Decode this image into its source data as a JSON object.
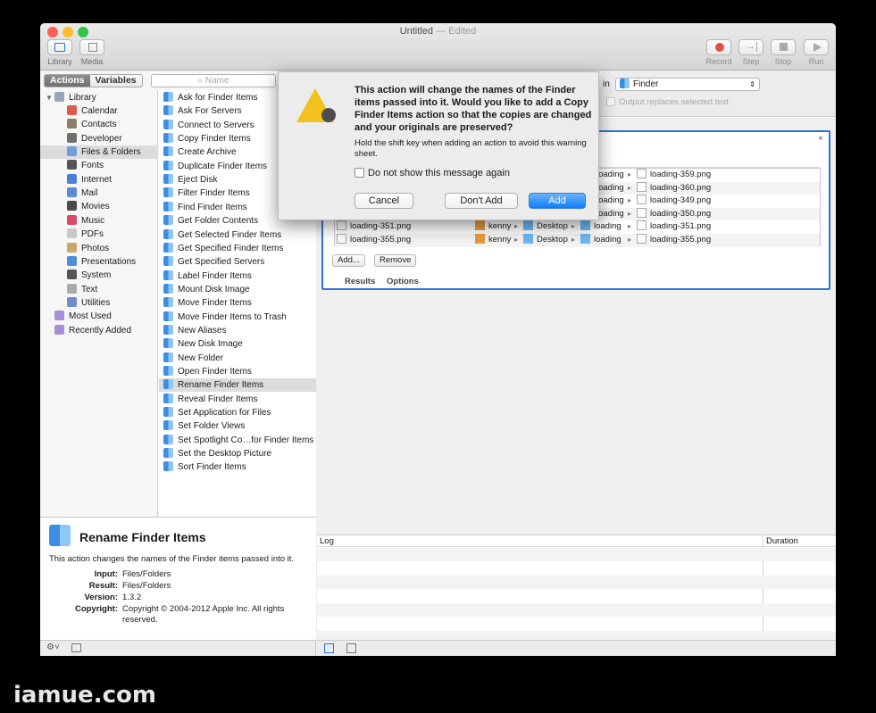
{
  "window": {
    "title": "Untitled",
    "edited": "— Edited"
  },
  "toolbar": {
    "library": "Library",
    "media": "Media",
    "record": "Record",
    "step": "Step",
    "stop": "Stop",
    "run": "Run"
  },
  "tabs": {
    "actions": "Actions",
    "variables": "Variables"
  },
  "search": {
    "placeholder": "Name"
  },
  "library": {
    "root": "Library",
    "items": [
      "Calendar",
      "Contacts",
      "Developer",
      "Files & Folders",
      "Fonts",
      "Internet",
      "Mail",
      "Movies",
      "Music",
      "PDFs",
      "Photos",
      "Presentations",
      "System",
      "Text",
      "Utilities"
    ],
    "selected": "Files & Folders",
    "most_used": "Most Used",
    "recently_added": "Recently Added"
  },
  "actions": {
    "items": [
      "Ask for Finder Items",
      "Ask For Servers",
      "Connect to Servers",
      "Copy Finder Items",
      "Create Archive",
      "Duplicate Finder Items",
      "Eject Disk",
      "Filter Finder Items",
      "Find Finder Items",
      "Get Folder Contents",
      "Get Selected Finder Items",
      "Get Specified Finder Items",
      "Get Specified Servers",
      "Label Finder Items",
      "Mount Disk Image",
      "Move Finder Items",
      "Move Finder Items to Trash",
      "New Aliases",
      "New Disk Image",
      "New Folder",
      "Open Finder Items",
      "Rename Finder Items",
      "Reveal Finder Items",
      "Set Application for Files",
      "Set Folder Views",
      "Set Spotlight Co…for Finder Items",
      "Set the Desktop Picture",
      "Sort Finder Items"
    ],
    "selected": "Rename Finder Items"
  },
  "description": {
    "title": "Rename Finder Items",
    "text": "This action changes the names of the Finder items passed into it.",
    "input_label": "Input:",
    "input": "Files/Folders",
    "result_label": "Result:",
    "result": "Files/Folders",
    "version_label": "Version:",
    "version": "1.3.2",
    "copyright_label": "Copyright:",
    "copyright": "Copyright © 2004-2012 Apple Inc.  All rights reserved."
  },
  "options_bar": {
    "in_label": "in",
    "app": "Finder",
    "output_replaces": "Output replaces selected text"
  },
  "action_box": {
    "rows": [
      {
        "name": "",
        "user": "",
        "desktop": "",
        "folder": "loading",
        "file": "loading-359.png"
      },
      {
        "name": "",
        "user": "",
        "desktop": "",
        "folder": "loading",
        "file": "loading-360.png"
      },
      {
        "name": "",
        "user": "",
        "desktop": "",
        "folder": "loading",
        "file": "loading-349.png"
      },
      {
        "name": "",
        "user": "",
        "desktop": "",
        "folder": "loading",
        "file": "loading-350.png"
      },
      {
        "name": "loading-351.png",
        "user": "kenny",
        "desktop": "Desktop",
        "folder": "loading",
        "file": "loading-351.png"
      },
      {
        "name": "loading-355.png",
        "user": "kenny",
        "desktop": "Desktop",
        "folder": "loading",
        "file": "loading-355.png"
      }
    ],
    "add_button": "Add...",
    "remove_button": "Remove",
    "results_tab": "Results",
    "options_tab": "Options"
  },
  "log": {
    "col_log": "Log",
    "col_duration": "Duration"
  },
  "dialog": {
    "message": "This action will change the names of the Finder items passed into it.  Would you like to add a Copy Finder Items action so that the copies are changed and your originals are preserved?",
    "info": "Hold the shift key when adding an action to avoid this warning sheet.",
    "checkbox": "Do not show this message again",
    "cancel": "Cancel",
    "dont_add": "Don't Add",
    "add": "Add"
  },
  "watermark": "iamue.com",
  "colors": {
    "accent": "#2f72d5",
    "default_button": "#1a82fb",
    "close": "#fc5f57",
    "minimize": "#fdbc2e",
    "zoom": "#33c748"
  }
}
